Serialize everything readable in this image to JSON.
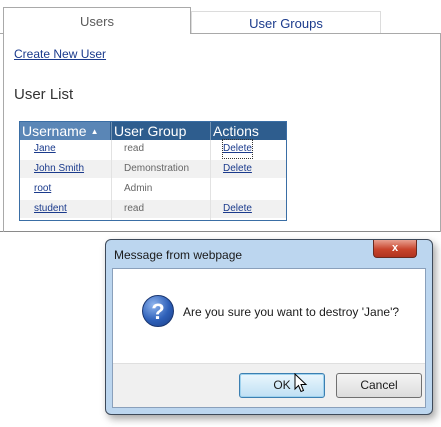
{
  "tabs": {
    "users": "Users",
    "user_groups": "User Groups"
  },
  "create_link": "Create New User",
  "list_heading": "User List",
  "table": {
    "columns": [
      "Username",
      "User Group",
      "Actions"
    ],
    "sort_indicator": "▲",
    "rows": [
      {
        "username": "Jane",
        "group": "read",
        "action": "Delete"
      },
      {
        "username": "John Smith",
        "group": "Demonstration",
        "action": "Delete"
      },
      {
        "username": "root",
        "group": "Admin",
        "action": ""
      },
      {
        "username": "student",
        "group": "read",
        "action": "Delete"
      }
    ]
  },
  "dialog": {
    "title": "Message from webpage",
    "close_glyph": "x",
    "icon_glyph": "?",
    "message": "Are you sure you want to destroy 'Jane'?",
    "ok": "OK",
    "cancel": "Cancel"
  },
  "colors": {
    "table_header": "#2e5d8e",
    "link": "#1a3a8c",
    "dialog_frame": "#bcd6ef"
  }
}
